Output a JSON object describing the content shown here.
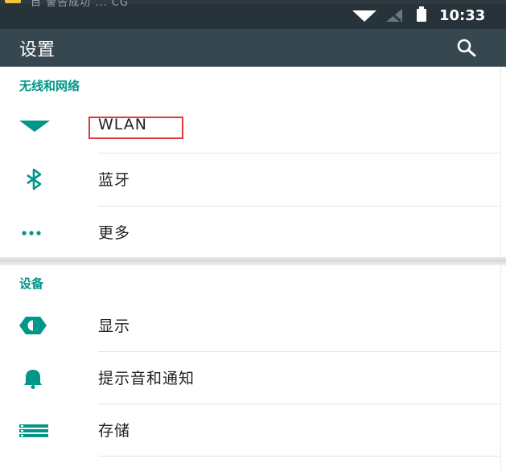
{
  "status_bar": {
    "time": "10:33",
    "notification_text": "目 警告成功 ... CG"
  },
  "toolbar": {
    "title": "设置"
  },
  "sections": [
    {
      "header": "无线和网络",
      "items": [
        {
          "label": "WLAN",
          "icon": "wifi-icon"
        },
        {
          "label": "蓝牙",
          "icon": "bluetooth-icon"
        },
        {
          "label": "更多",
          "icon": "more-icon"
        }
      ]
    },
    {
      "header": "设备",
      "items": [
        {
          "label": "显示",
          "icon": "brightness-icon"
        },
        {
          "label": "提示音和通知",
          "icon": "bell-icon"
        },
        {
          "label": "存储",
          "icon": "storage-icon"
        }
      ]
    }
  ],
  "colors": {
    "accent": "#009688",
    "toolbar": "#37474f",
    "status_bar": "#27333a",
    "highlight_box": "#e53935"
  }
}
